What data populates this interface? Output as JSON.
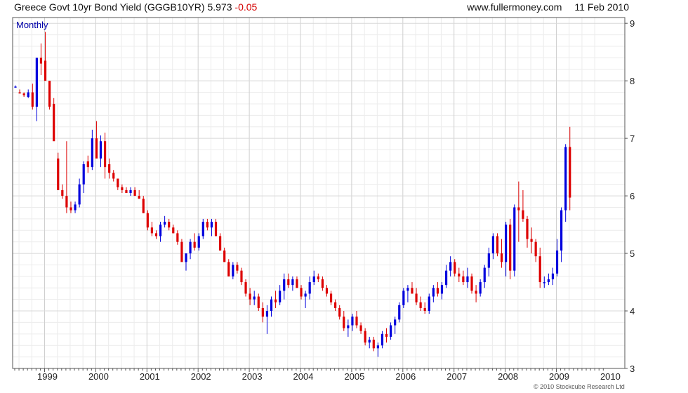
{
  "header": {
    "title": "Greece Govt 10yr Bond Yield (GGGB10YR)",
    "last": "5.973",
    "change": "-0.05",
    "site": "www.fullermoney.com",
    "date": "11 Feb 2010"
  },
  "footer": {
    "copyright": "© 2010 Stockcube Research Ltd"
  },
  "colors": {
    "up": "#0000dd",
    "down": "#dd0000",
    "grid": "#d8d8d8",
    "frame": "#555555",
    "period_label": "#0000aa"
  },
  "chart_data": {
    "type": "ohlc-bar",
    "period": "Monthly",
    "ylim": [
      3,
      9.1
    ],
    "y_ticks": [
      3,
      4,
      5,
      6,
      7,
      8,
      9
    ],
    "grid": true,
    "x_tick_labels": [
      "1999",
      "2000",
      "2001",
      "2002",
      "2003",
      "2004",
      "2005",
      "2006",
      "2007",
      "2008",
      "2009",
      "2010"
    ],
    "start_month": "1998-01",
    "series": [
      {
        "name": "Greece Govt 10yr Bond Yield",
        "candles": [
          [
            7.9,
            7.92,
            7.9,
            7.9
          ],
          [
            7.8,
            7.85,
            7.78,
            7.78
          ],
          [
            7.78,
            7.8,
            7.72,
            7.75
          ],
          [
            7.72,
            7.85,
            7.7,
            7.8
          ],
          [
            7.8,
            7.95,
            7.5,
            7.55
          ],
          [
            7.55,
            8.35,
            7.3,
            8.4
          ],
          [
            8.4,
            8.65,
            8.1,
            8.3
          ],
          [
            8.35,
            8.85,
            8.05,
            8.0
          ],
          [
            8.0,
            8.0,
            7.5,
            7.55
          ],
          [
            7.6,
            7.7,
            7.3,
            6.95
          ],
          [
            6.65,
            6.75,
            6.1,
            6.1
          ],
          [
            6.1,
            6.2,
            5.95,
            6.0
          ],
          [
            6.0,
            6.95,
            5.7,
            5.8
          ],
          [
            5.8,
            5.9,
            5.7,
            5.75
          ],
          [
            5.75,
            5.9,
            5.7,
            5.85
          ],
          [
            5.85,
            6.3,
            5.8,
            6.2
          ],
          [
            6.2,
            6.6,
            6.05,
            6.55
          ],
          [
            6.6,
            6.7,
            6.4,
            6.5
          ],
          [
            6.5,
            7.15,
            6.45,
            7.0
          ],
          [
            7.0,
            7.3,
            6.7,
            6.65
          ],
          [
            6.65,
            7.05,
            6.5,
            6.95
          ],
          [
            6.95,
            7.1,
            6.3,
            6.5
          ],
          [
            6.55,
            6.65,
            6.3,
            6.4
          ],
          [
            6.4,
            6.45,
            6.25,
            6.3
          ],
          [
            6.3,
            6.3,
            6.1,
            6.15
          ],
          [
            6.15,
            6.2,
            6.05,
            6.1
          ],
          [
            6.1,
            6.15,
            6.05,
            6.05
          ],
          [
            6.05,
            6.15,
            6.0,
            6.1
          ],
          [
            6.1,
            6.15,
            6.0,
            6.0
          ],
          [
            6.0,
            6.1,
            5.95,
            5.95
          ],
          [
            5.95,
            6.0,
            5.7,
            5.7
          ],
          [
            5.7,
            5.75,
            5.4,
            5.45
          ],
          [
            5.45,
            5.55,
            5.3,
            5.35
          ],
          [
            5.35,
            5.4,
            5.25,
            5.3
          ],
          [
            5.3,
            5.55,
            5.2,
            5.5
          ],
          [
            5.5,
            5.65,
            5.45,
            5.55
          ],
          [
            5.55,
            5.6,
            5.4,
            5.45
          ],
          [
            5.45,
            5.5,
            5.35,
            5.35
          ],
          [
            5.35,
            5.4,
            5.15,
            5.2
          ],
          [
            5.2,
            5.25,
            4.95,
            4.85
          ],
          [
            4.85,
            5.0,
            4.7,
            5.0
          ],
          [
            5.0,
            5.25,
            4.9,
            5.2
          ],
          [
            5.2,
            5.35,
            5.05,
            5.1
          ],
          [
            5.1,
            5.35,
            5.05,
            5.3
          ],
          [
            5.3,
            5.6,
            5.25,
            5.55
          ],
          [
            5.55,
            5.6,
            5.4,
            5.45
          ],
          [
            5.45,
            5.6,
            5.3,
            5.55
          ],
          [
            5.55,
            5.6,
            5.3,
            5.3
          ],
          [
            5.3,
            5.35,
            5.05,
            5.05
          ],
          [
            5.05,
            5.1,
            4.85,
            4.85
          ],
          [
            4.85,
            4.9,
            4.6,
            4.6
          ],
          [
            4.6,
            4.85,
            4.55,
            4.8
          ],
          [
            4.8,
            4.85,
            4.65,
            4.7
          ],
          [
            4.7,
            4.75,
            4.45,
            4.5
          ],
          [
            4.5,
            4.55,
            4.25,
            4.3
          ],
          [
            4.3,
            4.4,
            4.1,
            4.2
          ],
          [
            4.2,
            4.35,
            4.1,
            4.25
          ],
          [
            4.25,
            4.3,
            4.0,
            4.05
          ],
          [
            4.05,
            4.15,
            3.8,
            3.9
          ],
          [
            3.9,
            4.1,
            3.6,
            4.0
          ],
          [
            4.0,
            4.25,
            3.9,
            4.2
          ],
          [
            4.2,
            4.35,
            4.05,
            4.15
          ],
          [
            4.15,
            4.45,
            4.1,
            4.35
          ],
          [
            4.35,
            4.65,
            4.2,
            4.55
          ],
          [
            4.55,
            4.65,
            4.4,
            4.45
          ],
          [
            4.45,
            4.6,
            4.35,
            4.55
          ],
          [
            4.55,
            4.6,
            4.4,
            4.4
          ],
          [
            4.4,
            4.45,
            4.2,
            4.25
          ],
          [
            4.25,
            4.35,
            4.05,
            4.3
          ],
          [
            4.3,
            4.6,
            4.2,
            4.5
          ],
          [
            4.5,
            4.7,
            4.45,
            4.6
          ],
          [
            4.6,
            4.65,
            4.5,
            4.55
          ],
          [
            4.55,
            4.6,
            4.35,
            4.4
          ],
          [
            4.4,
            4.45,
            4.25,
            4.3
          ],
          [
            4.3,
            4.35,
            4.1,
            4.15
          ],
          [
            4.15,
            4.2,
            4.0,
            4.05
          ],
          [
            4.05,
            4.1,
            3.85,
            3.9
          ],
          [
            3.9,
            4.0,
            3.65,
            3.7
          ],
          [
            3.7,
            3.85,
            3.55,
            3.75
          ],
          [
            3.75,
            3.95,
            3.65,
            3.9
          ],
          [
            3.9,
            4.0,
            3.7,
            3.75
          ],
          [
            3.75,
            3.8,
            3.6,
            3.65
          ],
          [
            3.65,
            3.7,
            3.4,
            3.45
          ],
          [
            3.45,
            3.55,
            3.35,
            3.5
          ],
          [
            3.5,
            3.55,
            3.3,
            3.35
          ],
          [
            3.35,
            3.45,
            3.2,
            3.4
          ],
          [
            3.4,
            3.65,
            3.35,
            3.6
          ],
          [
            3.6,
            3.7,
            3.45,
            3.55
          ],
          [
            3.55,
            3.8,
            3.5,
            3.75
          ],
          [
            3.75,
            3.9,
            3.6,
            3.85
          ],
          [
            3.85,
            4.15,
            3.8,
            4.1
          ],
          [
            4.1,
            4.4,
            4.05,
            4.35
          ],
          [
            4.35,
            4.45,
            4.15,
            4.4
          ],
          [
            4.4,
            4.5,
            4.3,
            4.3
          ],
          [
            4.3,
            4.4,
            4.1,
            4.15
          ],
          [
            4.15,
            4.25,
            4.0,
            4.05
          ],
          [
            4.05,
            4.15,
            3.95,
            4.0
          ],
          [
            4.0,
            4.3,
            3.95,
            4.25
          ],
          [
            4.25,
            4.45,
            4.15,
            4.4
          ],
          [
            4.4,
            4.5,
            4.25,
            4.3
          ],
          [
            4.3,
            4.5,
            4.2,
            4.45
          ],
          [
            4.45,
            4.8,
            4.4,
            4.7
          ],
          [
            4.7,
            4.95,
            4.6,
            4.85
          ],
          [
            4.85,
            4.9,
            4.6,
            4.65
          ],
          [
            4.65,
            4.75,
            4.5,
            4.6
          ],
          [
            4.6,
            4.7,
            4.45,
            4.5
          ],
          [
            4.5,
            4.75,
            4.4,
            4.6
          ],
          [
            4.6,
            4.65,
            4.3,
            4.35
          ],
          [
            4.35,
            4.45,
            4.15,
            4.3
          ],
          [
            4.3,
            4.55,
            4.25,
            4.5
          ],
          [
            4.5,
            4.8,
            4.4,
            4.75
          ],
          [
            4.75,
            5.1,
            4.6,
            5.0
          ],
          [
            5.0,
            5.35,
            4.9,
            5.3
          ],
          [
            5.3,
            5.35,
            4.95,
            5.0
          ],
          [
            5.0,
            5.25,
            4.75,
            4.85
          ],
          [
            4.85,
            5.55,
            4.6,
            5.5
          ],
          [
            5.5,
            5.6,
            4.55,
            4.7
          ],
          [
            4.7,
            5.85,
            4.6,
            5.8
          ],
          [
            5.8,
            6.25,
            5.2,
            5.75
          ],
          [
            5.75,
            6.1,
            5.55,
            5.6
          ],
          [
            5.6,
            5.65,
            5.1,
            5.25
          ],
          [
            5.25,
            5.45,
            5.0,
            5.2
          ],
          [
            5.2,
            5.25,
            4.85,
            4.95
          ],
          [
            4.95,
            5.1,
            4.4,
            4.5
          ],
          [
            4.5,
            4.6,
            4.4,
            4.5
          ],
          [
            4.5,
            4.65,
            4.45,
            4.55
          ],
          [
            4.55,
            4.75,
            4.45,
            4.65
          ],
          [
            4.65,
            5.25,
            4.6,
            5.05
          ],
          [
            5.05,
            5.8,
            4.85,
            5.75
          ],
          [
            5.75,
            6.9,
            5.55,
            6.85
          ],
          [
            6.85,
            7.2,
            5.75,
            5.97
          ]
        ]
      }
    ]
  }
}
